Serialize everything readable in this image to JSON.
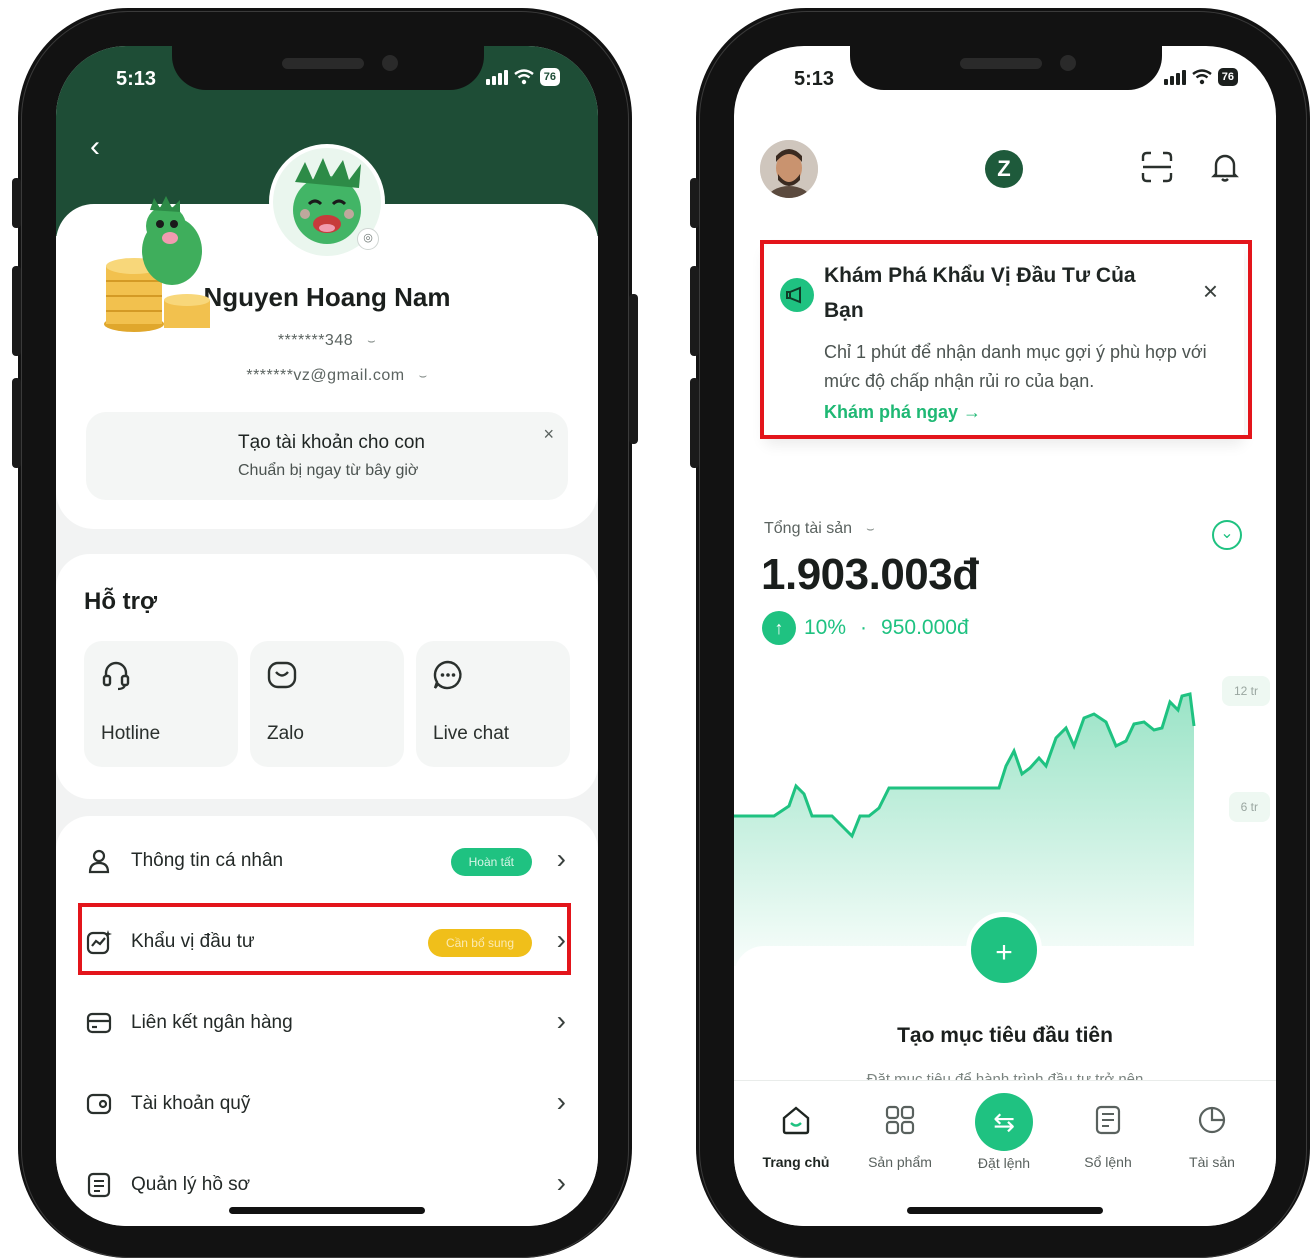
{
  "colors": {
    "brand_dark_green": "#1e4d36",
    "accent_green": "#1fc281",
    "warning_yellow": "#f0bf1a",
    "highlight_red": "#e3151b"
  },
  "left_screen": {
    "status": {
      "time": "5:13",
      "battery": "76"
    },
    "profile": {
      "name": "Nguyen Hoang Nam",
      "phone_masked": "*******348",
      "email_masked": "*******vz@gmail.com"
    },
    "promo": {
      "title": "Tạo tài khoản cho con",
      "subtitle": "Chuẩn bị ngay từ bây giờ",
      "close_icon": "close-icon"
    },
    "support": {
      "title": "Hỗ trợ",
      "items": [
        {
          "label": "Hotline",
          "icon": "headset-icon"
        },
        {
          "label": "Zalo",
          "icon": "message-bubble-icon"
        },
        {
          "label": "Live chat",
          "icon": "chat-dots-icon"
        }
      ]
    },
    "menu": [
      {
        "label": "Thông tin cá nhân",
        "icon": "user-icon",
        "badge": "Hoàn tất"
      },
      {
        "label": "Khẩu vị đầu tư",
        "icon": "chart-line-icon",
        "badge": "Cần bổ sung"
      },
      {
        "label": "Liên kết ngân hàng",
        "icon": "card-icon",
        "badge": ""
      },
      {
        "label": "Tài khoản quỹ",
        "icon": "wallet-icon",
        "badge": ""
      },
      {
        "label": "Quản lý hồ sơ",
        "icon": "document-icon",
        "badge": ""
      }
    ]
  },
  "right_screen": {
    "status": {
      "time": "5:13",
      "battery": "76"
    },
    "discover": {
      "title": "Khám Phá Khẩu Vị Đầu Tư Của Bạn",
      "description": "Chỉ 1 phút để nhận danh mục gợi ý phù hợp với mức độ chấp nhận rủi ro của bạn.",
      "link": "Khám phá ngay →"
    },
    "assets": {
      "label": "Tổng tài sản",
      "value": "1.903.003đ",
      "gain_percent": "10%",
      "gain_amount": "950.000đ"
    },
    "chart_ticks": {
      "high": "12 tr",
      "mid": "6 tr"
    },
    "goal": {
      "title": "Tạo mục tiêu đầu tiên",
      "subtitle": "Đặt mục tiêu để hành trình đầu tư trở nên"
    },
    "tabs": [
      {
        "label": "Trang chủ",
        "icon": "home-icon"
      },
      {
        "label": "Sản phẩm",
        "icon": "grid-icon"
      },
      {
        "label": "Đặt lệnh",
        "icon": "swap-icon"
      },
      {
        "label": "Sổ lệnh",
        "icon": "order-book-icon"
      },
      {
        "label": "Tài sản",
        "icon": "pie-icon"
      }
    ]
  }
}
